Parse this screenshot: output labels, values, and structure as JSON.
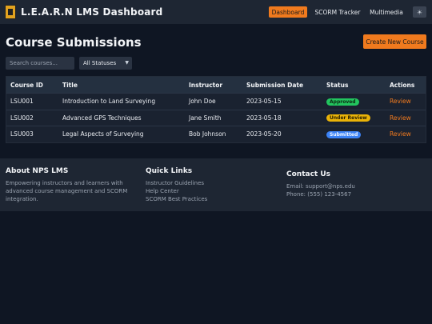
{
  "header": {
    "brand": "L.E.A.R.N LMS Dashboard",
    "nav": [
      "Dashboard",
      "SCORM Tracker",
      "Multimedia"
    ],
    "theme_toggle": "☀"
  },
  "main": {
    "title": "Course Submissions",
    "create_button": "Create New Course",
    "search_placeholder": "Search courses...",
    "status_filter": "All Statuses",
    "columns": [
      "Course ID",
      "Title",
      "Instructor",
      "Submission Date",
      "Status",
      "Actions"
    ],
    "rows": [
      {
        "id": "LSU001",
        "title": "Introduction to Land Surveying",
        "instructor": "John Doe",
        "date": "2023-05-15",
        "status": "Approved",
        "action": "Review"
      },
      {
        "id": "LSU002",
        "title": "Advanced GPS Techniques",
        "instructor": "Jane Smith",
        "date": "2023-05-18",
        "status": "Under Review",
        "action": "Review"
      },
      {
        "id": "LSU003",
        "title": "Legal Aspects of Surveying",
        "instructor": "Bob Johnson",
        "date": "2023-05-20",
        "status": "Submitted",
        "action": "Review"
      }
    ]
  },
  "footer": {
    "about_title": "About NPS LMS",
    "about_text": "Empowering instructors and learners with advanced course management and SCORM integration.",
    "links_title": "Quick Links",
    "links": [
      "Instructor Guidelines",
      "Help Center",
      "SCORM Best Practices"
    ],
    "contact_title": "Contact Us",
    "email": "Email: support@nps.edu",
    "phone": "Phone: (555) 123-4567"
  },
  "colors": {
    "accent": "#f07a1e",
    "approved": "#22c55e",
    "under_review": "#eab308",
    "submitted": "#3b82f6"
  }
}
